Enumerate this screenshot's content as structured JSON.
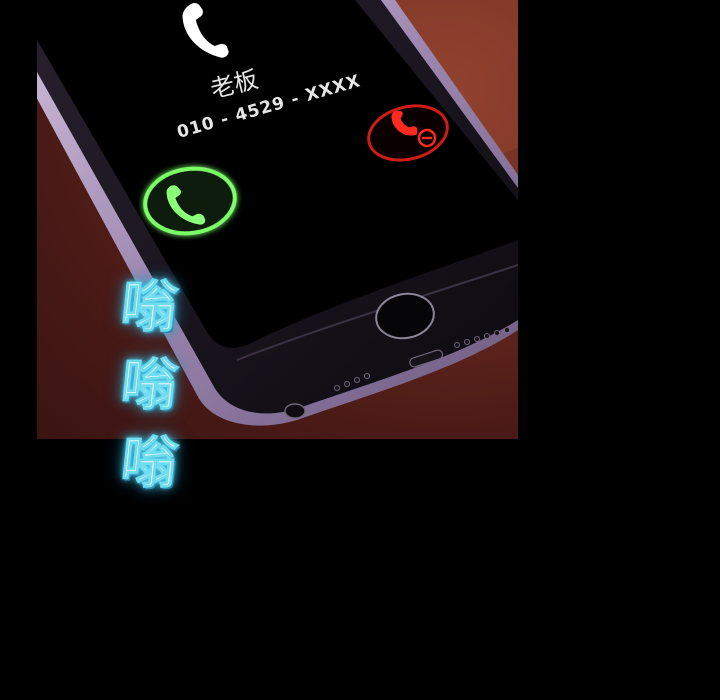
{
  "caller": {
    "name": "老板",
    "number": "010 - 4529 - XXXX"
  },
  "call_buttons": {
    "accept_icon": "phone-accept-icon",
    "decline_icon": "phone-decline-icon",
    "accept_color": "#7dff6a",
    "decline_color": "#e0201a"
  },
  "sound_effect": {
    "lines": [
      "嗡",
      "嗡",
      "嗡"
    ],
    "glow_color": "#5fd6ee"
  },
  "colors": {
    "background": "#000000",
    "table": "#5a2019",
    "screen": "#000000",
    "phone_frame": "#b9a3c8"
  }
}
